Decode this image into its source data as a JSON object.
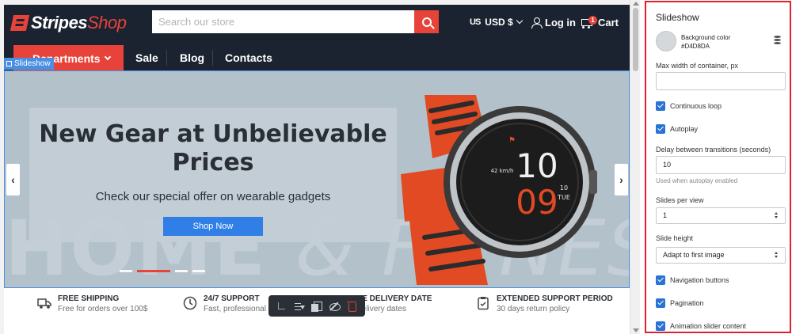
{
  "store": {
    "logo": {
      "part1": "Stripes",
      "part2": "Shop"
    },
    "search": {
      "placeholder": "Search our store"
    },
    "currency": {
      "flag": "US",
      "label": "USD $"
    },
    "login_label": "Log in",
    "cart": {
      "label": "Cart",
      "count": "1"
    },
    "nav": {
      "departments": "Departments",
      "links": [
        "Sale",
        "Blog",
        "Contacts"
      ]
    },
    "section_tag": "Slideshow",
    "slide": {
      "title": "New Gear at Unbelievable Prices",
      "subtitle": "Check our special offer on wearable gadgets",
      "button": "Shop Now",
      "bg_text_a": "HOME",
      "bg_text_b": "& FITNESS",
      "watch_hour": "10",
      "watch_min": "09",
      "watch_small": "42 km/h",
      "watch_day": "TUE",
      "watch_date": "10",
      "active_slide": 1,
      "slide_count": 4
    },
    "features": [
      {
        "icon": "truck-icon",
        "title": "Free Shipping",
        "desc": "Free for orders over 100$"
      },
      {
        "icon": "clock-icon",
        "title": "24/7 Support",
        "desc": "Fast, professional su"
      },
      {
        "icon": "calendar-icon",
        "title": "oose Delivery Date",
        "desc": "ble delivery dates"
      },
      {
        "icon": "clipboard-check-icon",
        "title": "Extended Support Period",
        "desc": "30 days return policy"
      }
    ]
  },
  "panel": {
    "title": "Slideshow",
    "background": {
      "label": "Background color",
      "value": "#D4D8DA",
      "color": "#D4D8DA"
    },
    "max_width": {
      "label": "Max width of container, px",
      "value": ""
    },
    "continuous_loop": {
      "label": "Continuous loop",
      "checked": true
    },
    "autoplay": {
      "label": "Autoplay",
      "checked": true
    },
    "delay": {
      "label": "Delay between transitions (seconds)",
      "value": "10",
      "hint": "Used when autoplay enabled"
    },
    "slides_per_view": {
      "label": "Slides per view",
      "value": "1"
    },
    "slide_height": {
      "label": "Slide height",
      "value": "Adapt to first image"
    },
    "navigation_buttons": {
      "label": "Navigation buttons",
      "checked": true
    },
    "pagination": {
      "label": "Pagination",
      "checked": true
    },
    "animation": {
      "label": "Animation slider content",
      "checked": true
    }
  },
  "colors": {
    "accent_red": "#e8433a",
    "header_dark": "#1b2330",
    "selection_blue": "#4a90e2",
    "checkbox_blue": "#2a73d6",
    "panel_border": "#e0202f"
  }
}
